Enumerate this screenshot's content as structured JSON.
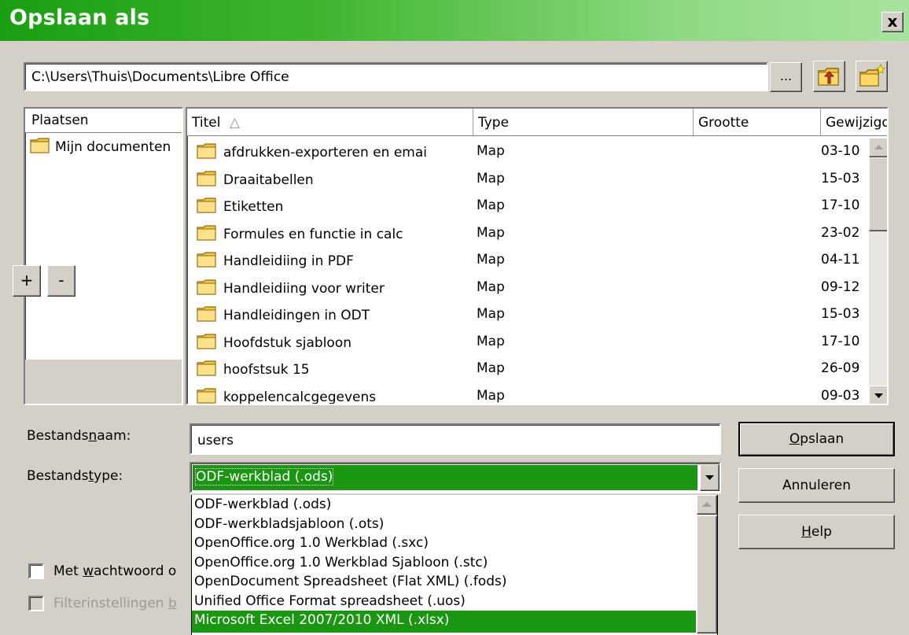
{
  "window": {
    "title": "Opslaan als",
    "close_label": "x"
  },
  "path": {
    "value": "C:\\Users\\Thuis\\Documents\\Libre Office",
    "browse_label": "..."
  },
  "places": {
    "header": "Plaatsen",
    "items": [
      "Mijn documenten"
    ],
    "add_label": "+",
    "remove_label": "-"
  },
  "files": {
    "columns": {
      "title": "Titel",
      "sort_indicator": "△",
      "type": "Type",
      "size": "Grootte",
      "modified": "Gewijzigd"
    },
    "rows": [
      {
        "name": "afdrukken-exporteren en  emai",
        "type": "Map",
        "date": "03-10"
      },
      {
        "name": "Draaitabellen",
        "type": "Map",
        "date": "15-03"
      },
      {
        "name": "Etiketten",
        "type": "Map",
        "date": "17-10"
      },
      {
        "name": "Formules en functie in calc",
        "type": "Map",
        "date": "23-02"
      },
      {
        "name": "Handleidiing in PDF",
        "type": "Map",
        "date": "04-11"
      },
      {
        "name": "Handleidiing voor writer",
        "type": "Map",
        "date": "09-12"
      },
      {
        "name": "Handleidingen in ODT",
        "type": "Map",
        "date": "15-03"
      },
      {
        "name": "Hoofdstuk sjabloon",
        "type": "Map",
        "date": "17-10"
      },
      {
        "name": "hoofstsuk 15",
        "type": "Map",
        "date": "26-09"
      },
      {
        "name": "koppelencalcgegevens",
        "type": "Map",
        "date": "09-03"
      }
    ]
  },
  "form": {
    "filename_label_pre": "Bestands",
    "filename_label_u": "n",
    "filename_label_post": "aam:",
    "filename_value": "users",
    "filetype_label_pre": "Bestands",
    "filetype_label_u": "t",
    "filetype_label_post": "ype:",
    "filetype_value": "ODF-werkblad (.ods)",
    "filetype_options": [
      "ODF-werkblad (.ods)",
      "ODF-werkbladsjabloon (.ots)",
      "OpenOffice.org 1.0 Werkblad (.sxc)",
      "OpenOffice.org 1.0 Werkblad Sjabloon (.stc)",
      "OpenDocument Spreadsheet (Flat XML) (.fods)",
      "Unified Office Format spreadsheet (.uos)",
      "Microsoft Excel 2007/2010 XML (.xlsx)"
    ],
    "password_label_pre": "Met ",
    "password_label_u": "w",
    "password_label_post": "achtwoord o",
    "filter_label_pre": "Filterinstellingen ",
    "filter_label_u": "b"
  },
  "buttons": {
    "save_u": "O",
    "save_rest": "pslaan",
    "cancel": "Annuleren",
    "help_u": "H",
    "help_rest": "elp"
  },
  "colors": {
    "titlebar_start": "#1a9e12",
    "selection": "#1a9612",
    "face": "#d4d0c8"
  }
}
